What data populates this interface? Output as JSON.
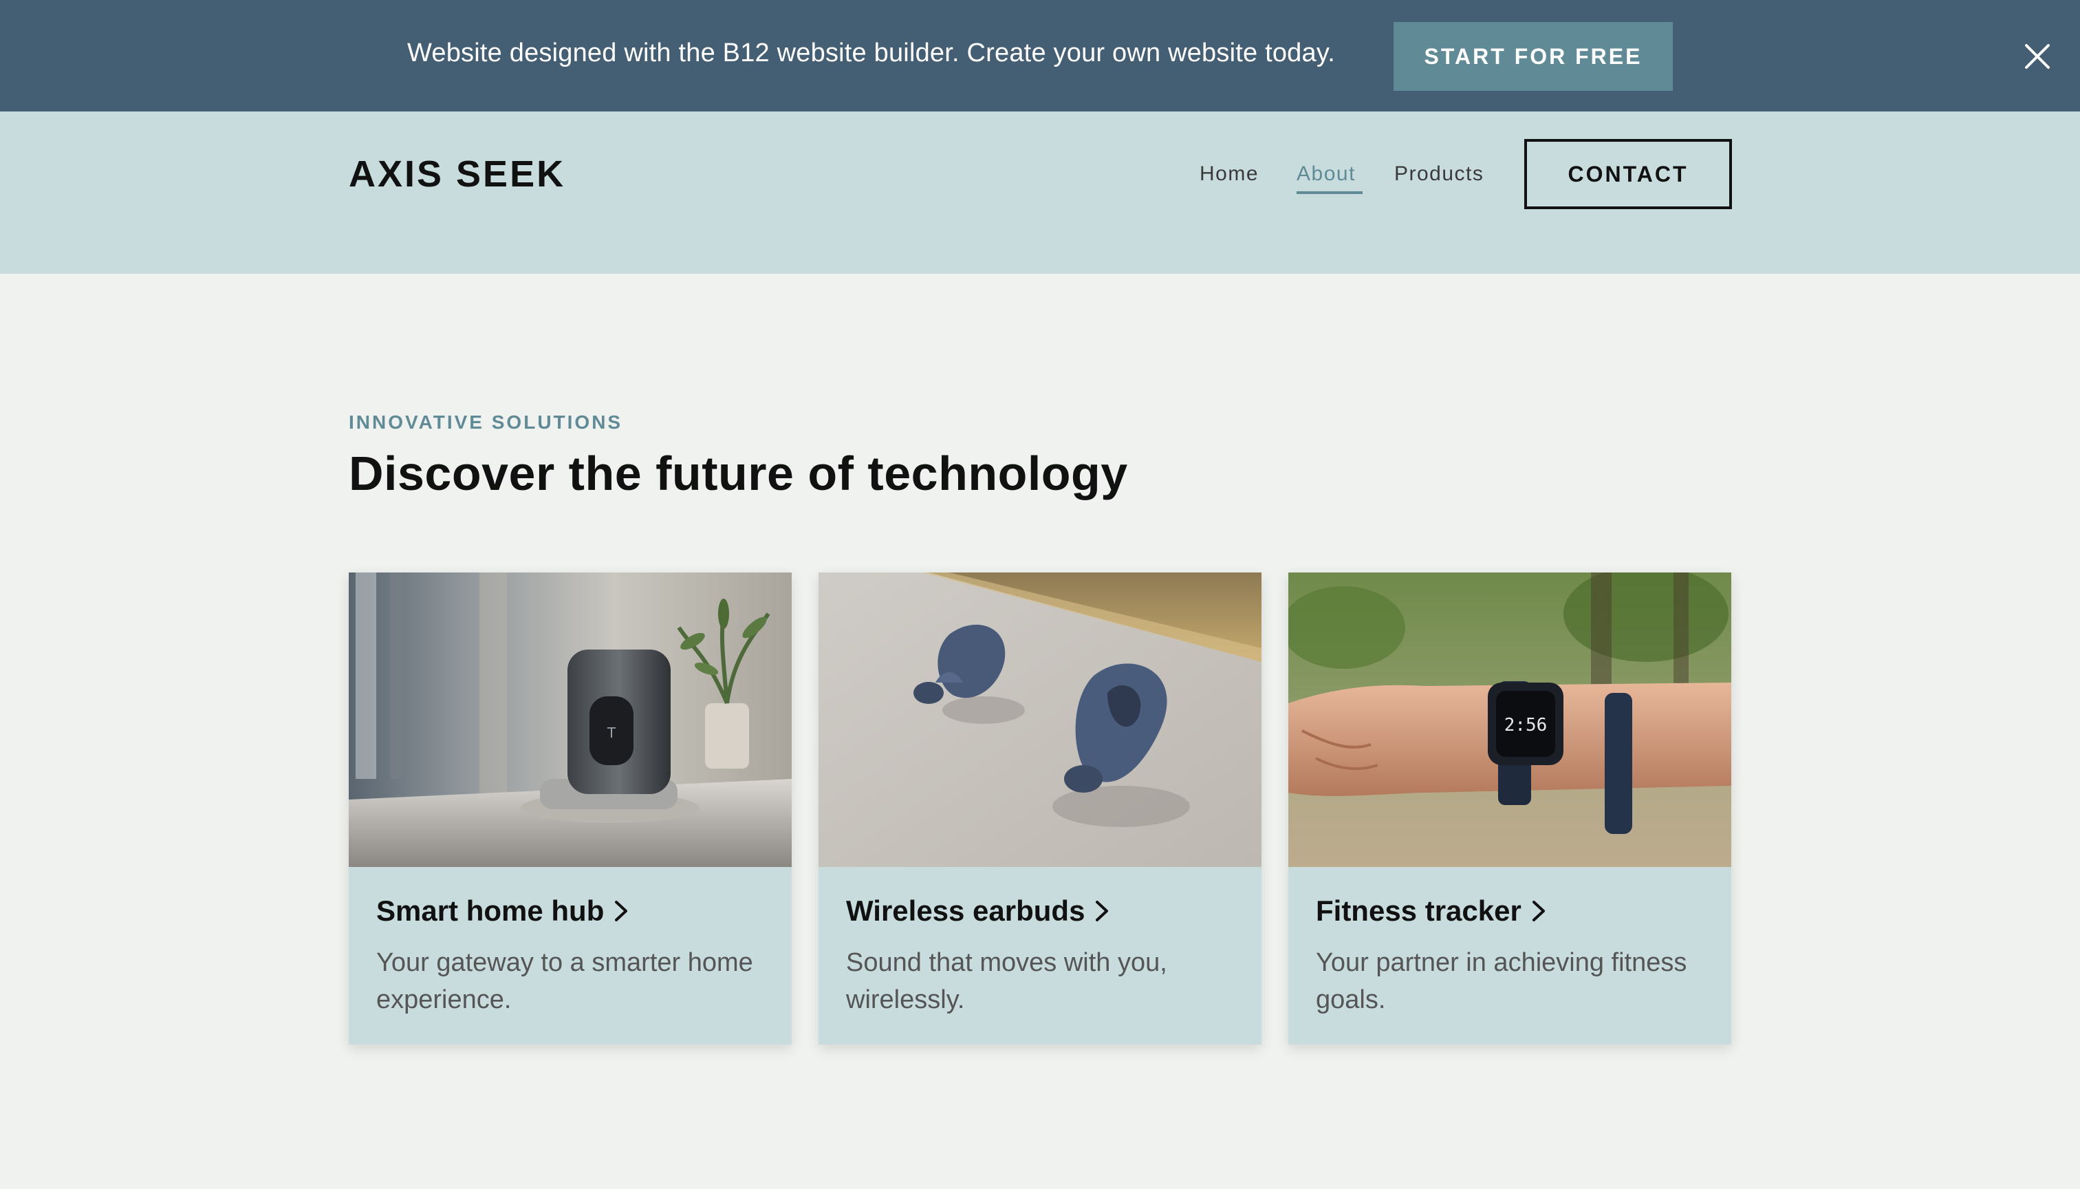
{
  "promo": {
    "text": "Website designed with the B12 website builder. Create your own website today.",
    "button_label": "START FOR FREE",
    "close_icon": "close-icon"
  },
  "header": {
    "logo": "AXIS SEEK",
    "nav": [
      {
        "label": "Home",
        "active": false
      },
      {
        "label": "About",
        "active": true
      },
      {
        "label": "Products",
        "active": false
      }
    ],
    "contact_label": "CONTACT"
  },
  "hero": {
    "eyebrow": "INNOVATIVE SOLUTIONS",
    "headline": "Discover the future of technology"
  },
  "cards": [
    {
      "title": "Smart home hub",
      "description": "Your gateway to a smarter home experience.",
      "icon": "chevron-right-icon"
    },
    {
      "title": "Wireless earbuds",
      "description": "Sound that moves with you, wirelessly.",
      "icon": "chevron-right-icon"
    },
    {
      "title": "Fitness tracker",
      "description": "Your partner in achieving fitness goals.",
      "icon": "chevron-right-icon"
    }
  ],
  "colors": {
    "banner": "#445e73",
    "accent": "#5f8a96",
    "header_bg": "#c8dcdd",
    "page_bg": "#f0f2ef",
    "card_bg": "#c8dcdd"
  }
}
